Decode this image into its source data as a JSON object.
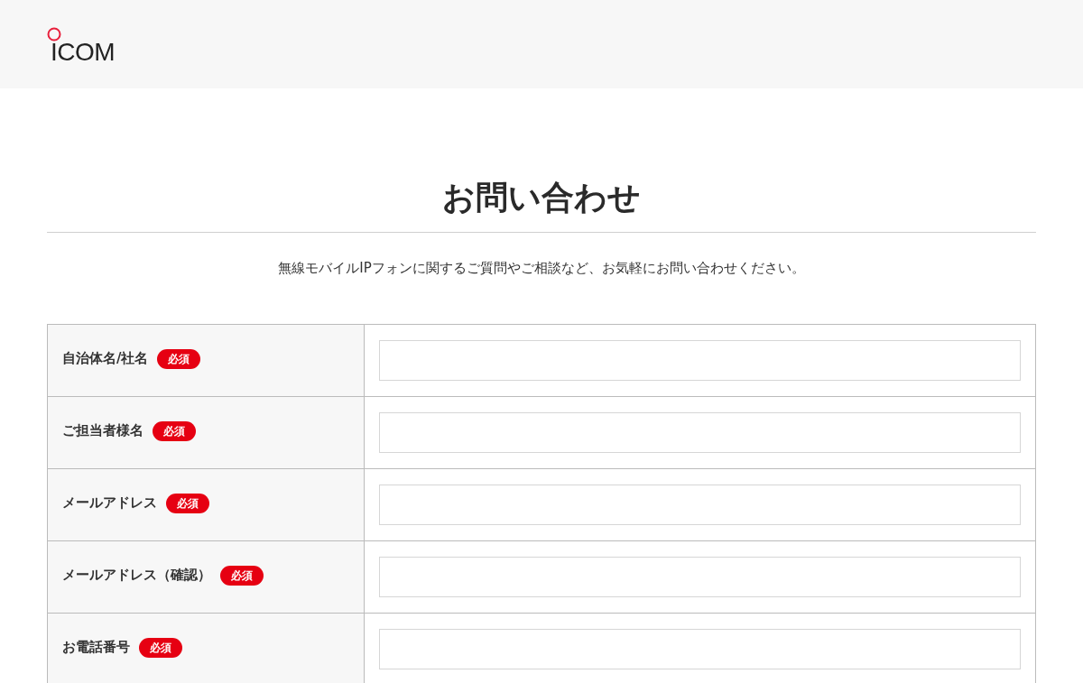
{
  "header": {
    "logo": "ICOM"
  },
  "title": "お問い合わせ",
  "intro": "無線モバイルIPフォンに関するご質問やご相談など、お気軽にお問い合わせください。",
  "form": {
    "rows": [
      {
        "label": "自治体名/社名",
        "badge": "必須"
      },
      {
        "label": "ご担当者様名",
        "badge": "必須"
      },
      {
        "label": "メールアドレス",
        "badge": "必須"
      },
      {
        "label": "メールアドレス（確認）",
        "badge": "必須"
      },
      {
        "label": "お電話番号",
        "badge": "必須"
      }
    ]
  }
}
